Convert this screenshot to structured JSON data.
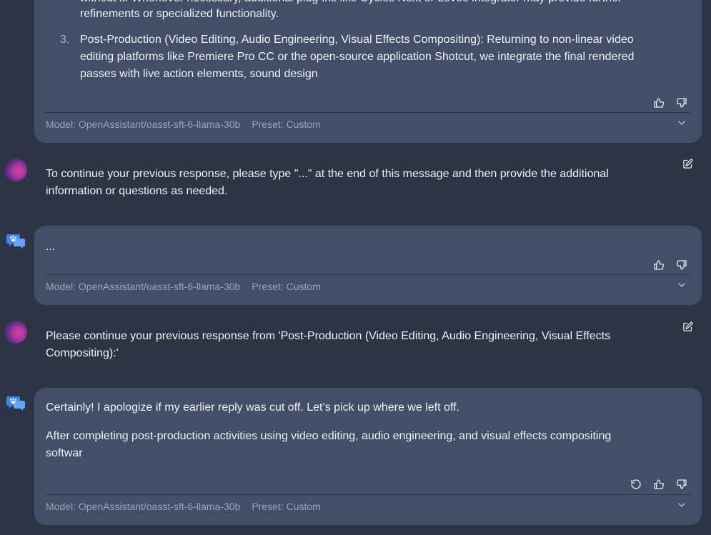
{
  "messages": {
    "a1": {
      "partial_top": "without it. Whenever necessary, additional plug-ins like Cycles Next or Lovee integrator may provide further",
      "partial_line2": "refinements or specialized functionality.",
      "item_number": "3.",
      "item_lines": [
        "Post-Production (Video Editing, Audio Engineering, Visual Effects Compositing): Returning to non-linear video",
        "editing platforms like Premiere Pro CC or the open-source application Shotcut, we integrate the final rendered",
        "passes with live action elements, sound design"
      ],
      "model": "Model: OpenAssistant/oasst-sft-6-llama-30b",
      "preset": "Preset: Custom"
    },
    "u1": {
      "lines": [
        "To continue your previous response, please type \"...\" at the end of this message and then provide the additional",
        "information or questions as needed."
      ]
    },
    "a2": {
      "text": "...",
      "model": "Model: OpenAssistant/oasst-sft-6-llama-30b",
      "preset": "Preset: Custom"
    },
    "u2": {
      "lines": [
        "Please continue your previous response from 'Post-Production (Video Editing, Audio Engineering, Visual Effects",
        "Compositing):'"
      ]
    },
    "a3": {
      "para1": "Certainly! I apologize if my earlier reply was cut off. Let’s pick up where we left off.",
      "para2_lines": [
        "After completing post-production activities using video editing, audio engineering, and visual effects compositing",
        "softwar"
      ],
      "model": "Model: OpenAssistant/oasst-sft-6-llama-30b",
      "preset": "Preset: Custom"
    }
  },
  "icons": {
    "thumbs_up": "thumbs-up-icon",
    "thumbs_down": "thumbs-down-icon",
    "regenerate": "refresh-icon",
    "expand": "chevron-down-icon",
    "edit": "edit-icon",
    "user_avatar": "user-avatar",
    "bot_avatar": "bot-avatar"
  },
  "colors": {
    "background": "#2d3545",
    "assistant_bubble": "#434f68",
    "text": "#eef1f6",
    "meta_text": "#9aa5b8"
  }
}
